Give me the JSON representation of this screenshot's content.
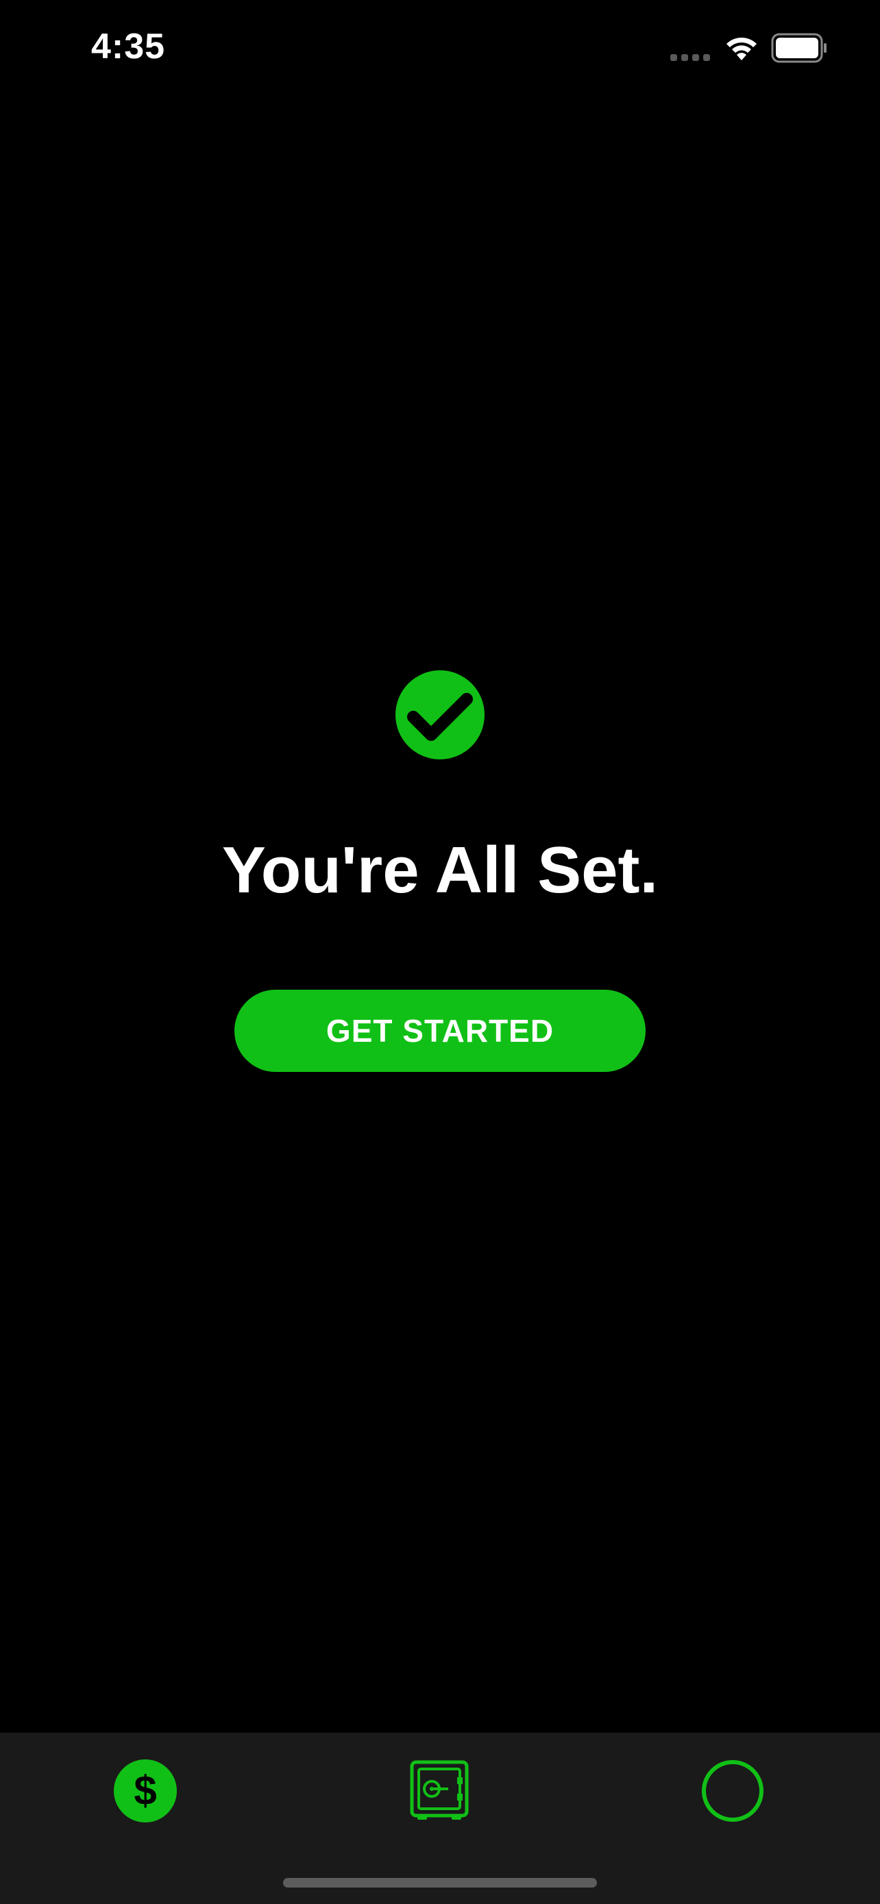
{
  "status_bar": {
    "time": "4:35"
  },
  "main": {
    "title": "You're All Set.",
    "button_label": "GET STARTED"
  },
  "tab_bar": {
    "tabs": [
      {
        "icon": "dollar-icon"
      },
      {
        "icon": "vault-icon"
      },
      {
        "icon": "circle-icon"
      }
    ]
  },
  "colors": {
    "background": "#000000",
    "accent": "#11c016",
    "tab_bar_background": "#1a1a1a",
    "text": "#ffffff"
  }
}
